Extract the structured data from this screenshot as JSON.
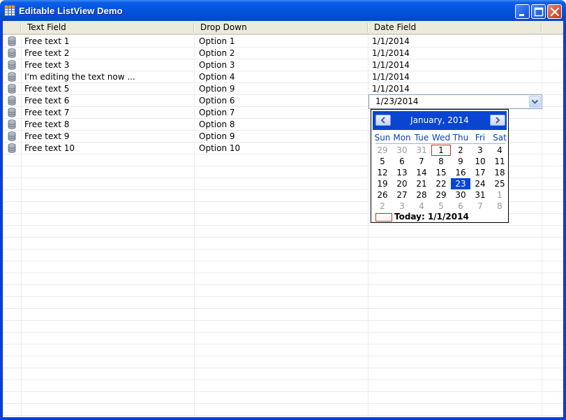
{
  "window": {
    "title": "Editable ListView Demo",
    "titlebar_color": "#0455e0"
  },
  "listview": {
    "columns": [
      "Text Field",
      "Drop Down",
      "Date Field"
    ],
    "rows": [
      {
        "text": "Free text 1",
        "option": "Option 1",
        "date": "1/1/2014"
      },
      {
        "text": "Free text 2",
        "option": "Option 2",
        "date": "1/1/2014"
      },
      {
        "text": "Free text 3",
        "option": "Option 3",
        "date": "1/1/2014"
      },
      {
        "text": "I'm editing the text now ...",
        "option": "Option 4",
        "date": "1/1/2014"
      },
      {
        "text": "Free text 5",
        "option": "Option 9",
        "date": "1/1/2014"
      },
      {
        "text": "Free text 6",
        "option": "Option 6",
        "date": ""
      },
      {
        "text": "Free text 7",
        "option": "Option 7",
        "date": ""
      },
      {
        "text": "Free text 8",
        "option": "Option 8",
        "date": ""
      },
      {
        "text": "Free text 9",
        "option": "Option 9",
        "date": ""
      },
      {
        "text": "Free text 10",
        "option": "Option 10",
        "date": ""
      }
    ],
    "row_icon": "database-icon"
  },
  "date_editor": {
    "value": "1/23/2014"
  },
  "calendar": {
    "month_title": "January, 2014",
    "days_of_week": [
      "Sun",
      "Mon",
      "Tue",
      "Wed",
      "Thu",
      "Fri",
      "Sat"
    ],
    "weeks": [
      [
        "29",
        "30",
        "31",
        "1",
        "2",
        "3",
        "4"
      ],
      [
        "5",
        "6",
        "7",
        "8",
        "9",
        "10",
        "11"
      ],
      [
        "12",
        "13",
        "14",
        "15",
        "16",
        "17",
        "18"
      ],
      [
        "19",
        "20",
        "21",
        "22",
        "23",
        "24",
        "25"
      ],
      [
        "26",
        "27",
        "28",
        "29",
        "30",
        "31",
        "1"
      ],
      [
        "2",
        "3",
        "4",
        "5",
        "6",
        "7",
        "8"
      ]
    ],
    "selected_day": "23",
    "today_day": "1",
    "today_label": "Today: 1/1/2014",
    "accent_color": "#0a45d2",
    "today_marker_color": "#c03020"
  }
}
